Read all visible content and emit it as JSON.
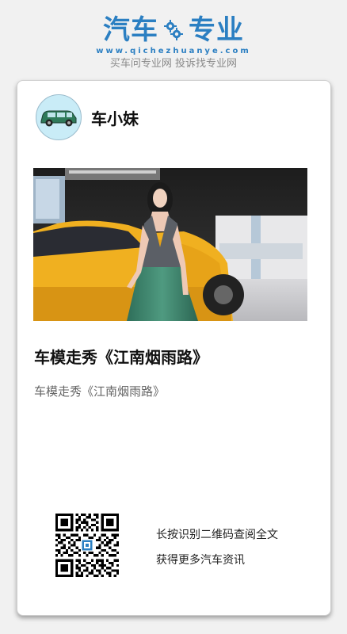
{
  "brand": {
    "logo_left": "汽车",
    "logo_right": "专业",
    "url": "www.qichezhuanye.com",
    "slogan": "买车问专业网 投诉找专业网",
    "color": "#2b7fc2"
  },
  "author": {
    "name": "车小妹",
    "avatar_icon": "car-icon"
  },
  "article": {
    "photo_description_icon": "car-show-model-photo",
    "title": "车模走秀《江南烟雨路》",
    "summary": "车模走秀《江南烟雨路》"
  },
  "qr": {
    "line1": "长按识别二维码查阅全文",
    "line2": "获得更多汽车资讯",
    "icon": "qr-code-icon"
  }
}
